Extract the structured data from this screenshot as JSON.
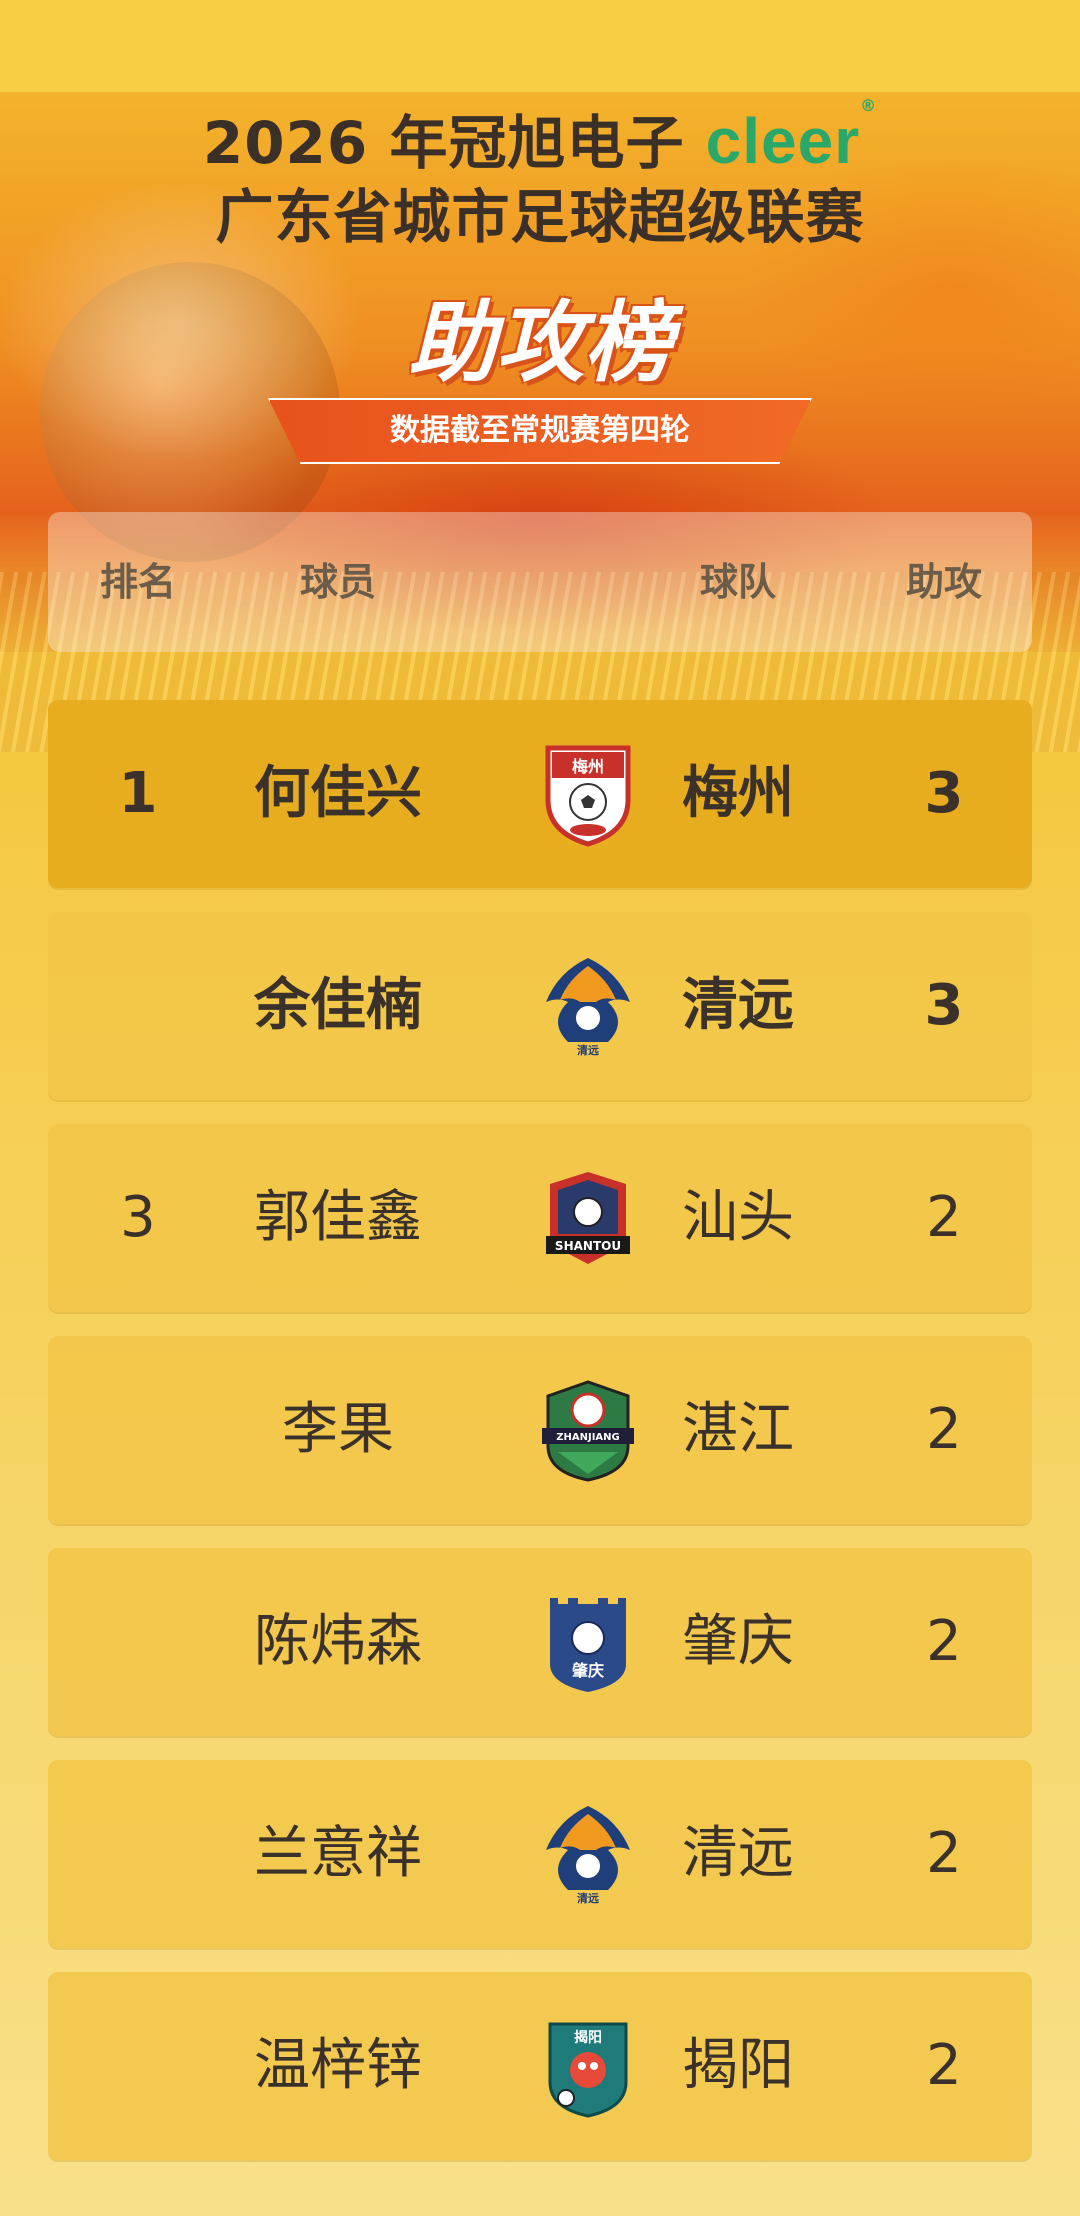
{
  "header": {
    "title_year": "2026 年冠旭电子",
    "brand": "cleer",
    "brand_mark": "®",
    "title_line2": "广东省城市足球超级联赛",
    "main_title": "助攻榜",
    "subtitle": "数据截至常规赛第四轮"
  },
  "table": {
    "columns": [
      "排名",
      "球员",
      "球队",
      "助攻"
    ],
    "rows": [
      {
        "rank": "1",
        "player": "何佳兴",
        "team": "梅州",
        "assists": "3",
        "logo": "meizhou-logo",
        "logo_text": "梅州"
      },
      {
        "rank": "",
        "player": "余佳楠",
        "team": "清远",
        "assists": "3",
        "logo": "qingyuan-logo",
        "logo_text": "清远"
      },
      {
        "rank": "3",
        "player": "郭佳鑫",
        "team": "汕头",
        "assists": "2",
        "logo": "shantou-logo",
        "logo_text": "SHANTOU"
      },
      {
        "rank": "",
        "player": "李果",
        "team": "湛江",
        "assists": "2",
        "logo": "zhanjiang-logo",
        "logo_text": "ZHANJIANG"
      },
      {
        "rank": "",
        "player": "陈炜森",
        "team": "肇庆",
        "assists": "2",
        "logo": "zhaoqing-logo",
        "logo_text": "肇庆"
      },
      {
        "rank": "",
        "player": "兰意祥",
        "team": "清远",
        "assists": "2",
        "logo": "qingyuan-logo",
        "logo_text": "清远"
      },
      {
        "rank": "",
        "player": "温梓锌",
        "team": "揭阳",
        "assists": "2",
        "logo": "jieyang-logo",
        "logo_text": "揭阳"
      }
    ]
  },
  "colors": {
    "brand_green": "#29a86a",
    "accent_orange": "#e8521d",
    "highlight_row": "#e8ad1e",
    "row": "#f2c648"
  }
}
